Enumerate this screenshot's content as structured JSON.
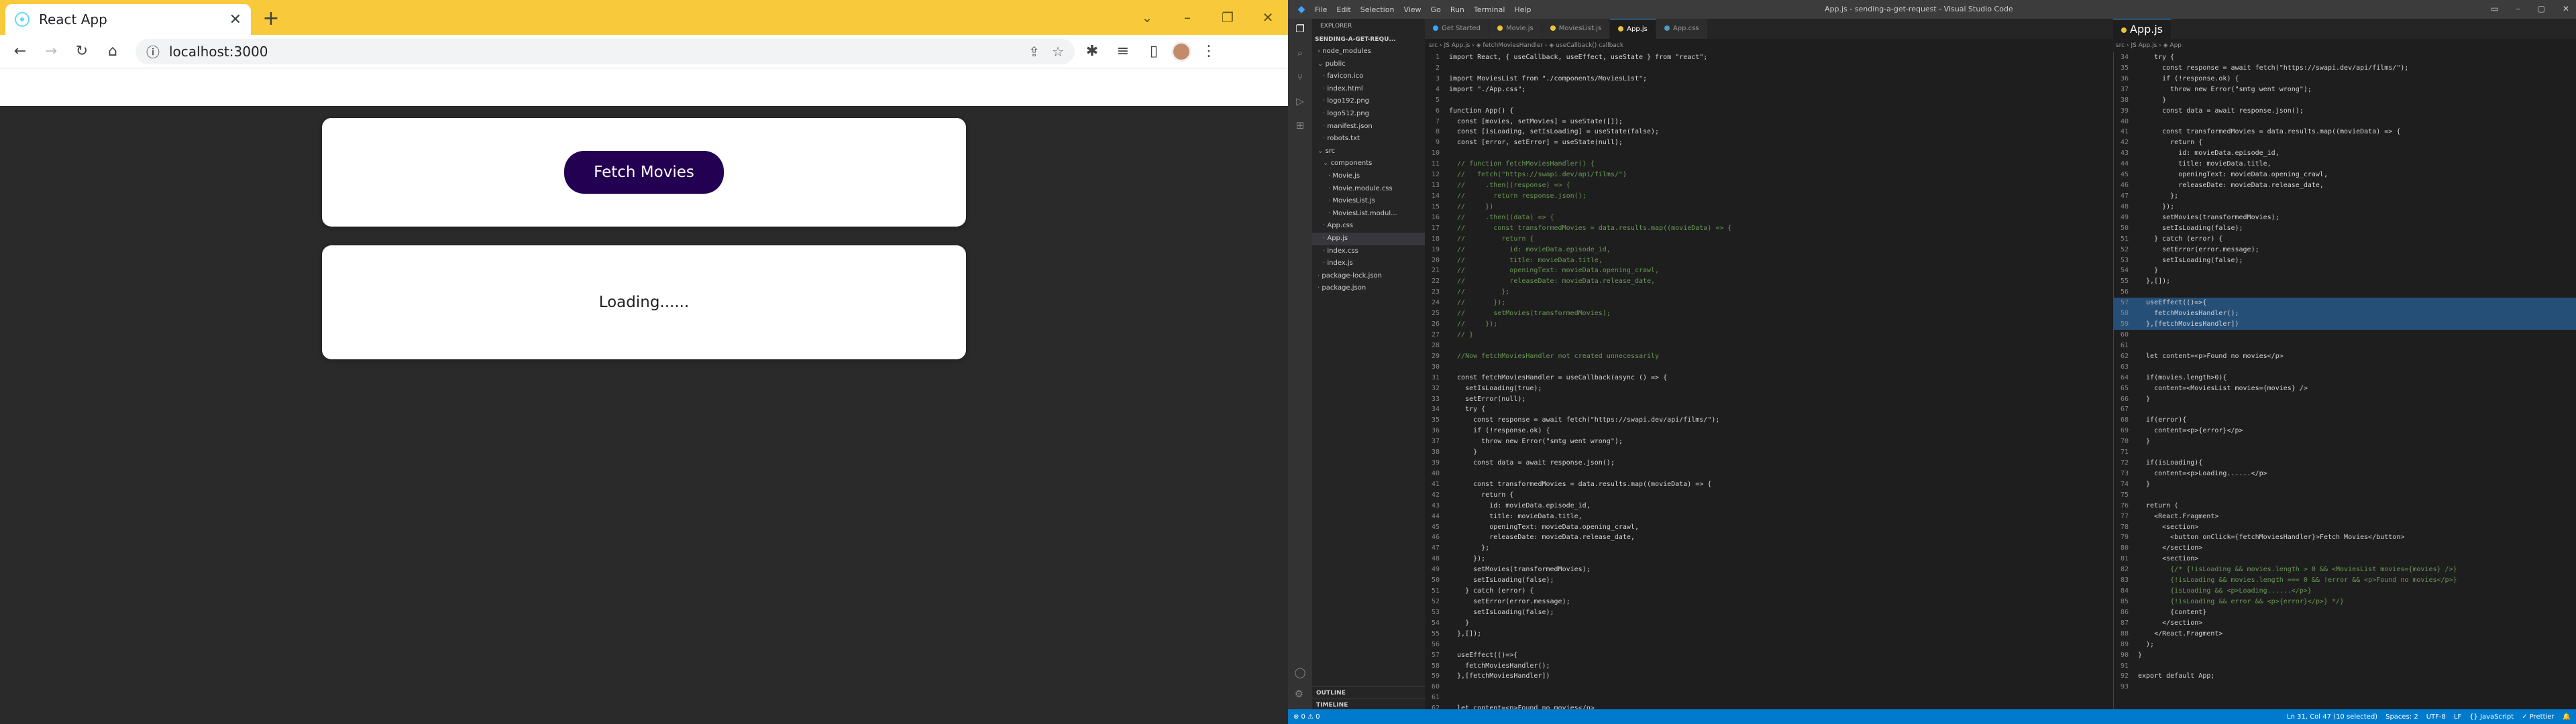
{
  "browser": {
    "tab_title": "React App",
    "tab_close": "✕",
    "new_tab": "+",
    "url": "localhost:3000",
    "window_controls": [
      "⌄",
      "–",
      "❐",
      "✕"
    ]
  },
  "app": {
    "fetch_button_label": "Fetch Movies",
    "loading_text": "Loading......"
  },
  "vscode": {
    "menu": [
      "File",
      "Edit",
      "Selection",
      "View",
      "Go",
      "Run",
      "Terminal",
      "Help"
    ],
    "window_title": "App.js - sending-a-get-request - Visual Studio Code",
    "explorer_header": "EXPLORER",
    "project_name": "SENDING-A-GET-REQU...",
    "tree": [
      {
        "label": "node_modules",
        "indent": 1,
        "arrow": "›"
      },
      {
        "label": "public",
        "indent": 1,
        "arrow": "⌄"
      },
      {
        "label": "favicon.ico",
        "indent": 2,
        "arrow": ""
      },
      {
        "label": "index.html",
        "indent": 2,
        "arrow": ""
      },
      {
        "label": "logo192.png",
        "indent": 2,
        "arrow": ""
      },
      {
        "label": "logo512.png",
        "indent": 2,
        "arrow": ""
      },
      {
        "label": "manifest.json",
        "indent": 2,
        "arrow": ""
      },
      {
        "label": "robots.txt",
        "indent": 2,
        "arrow": ""
      },
      {
        "label": "src",
        "indent": 1,
        "arrow": "⌄"
      },
      {
        "label": "components",
        "indent": 2,
        "arrow": "⌄"
      },
      {
        "label": "Movie.js",
        "indent": 3,
        "arrow": ""
      },
      {
        "label": "Movie.module.css",
        "indent": 3,
        "arrow": ""
      },
      {
        "label": "MoviesList.js",
        "indent": 3,
        "arrow": ""
      },
      {
        "label": "MoviesList.modul...",
        "indent": 3,
        "arrow": ""
      },
      {
        "label": "App.css",
        "indent": 2,
        "arrow": ""
      },
      {
        "label": "App.js",
        "indent": 2,
        "arrow": "",
        "selected": true
      },
      {
        "label": "index.css",
        "indent": 2,
        "arrow": ""
      },
      {
        "label": "index.js",
        "indent": 2,
        "arrow": ""
      },
      {
        "label": "package-lock.json",
        "indent": 1,
        "arrow": ""
      },
      {
        "label": "package.json",
        "indent": 1,
        "arrow": ""
      }
    ],
    "outline": "OUTLINE",
    "timeline": "TIMELINE",
    "tabs": [
      {
        "label": "Get Started",
        "color": "#3aa6ff"
      },
      {
        "label": "Movie.js",
        "color": "#e8c43a"
      },
      {
        "label": "MoviesList.js",
        "color": "#e8c43a"
      },
      {
        "label": "App.js",
        "color": "#e8c43a",
        "active": true
      },
      {
        "label": "App.css",
        "color": "#519aba"
      }
    ],
    "right_tab": "App.js",
    "breadcrumb_left": "src  ›  JS App.js  ›  ◈ fetchMoviesHandler  ›  ◈ useCallback() callback",
    "breadcrumb_right": "src  ›  JS App.js  ›  ◈ App",
    "code_left": [
      {
        "n": "1",
        "t": "import React, { useCallback, useEffect, useState } from \"react\";"
      },
      {
        "n": "2",
        "t": ""
      },
      {
        "n": "3",
        "t": "import MoviesList from \"./components/MoviesList\";"
      },
      {
        "n": "4",
        "t": "import \"./App.css\";"
      },
      {
        "n": "5",
        "t": ""
      },
      {
        "n": "6",
        "t": "function App() {"
      },
      {
        "n": "7",
        "t": "  const [movies, setMovies] = useState([]);"
      },
      {
        "n": "8",
        "t": "  const [isLoading, setIsLoading] = useState(false);"
      },
      {
        "n": "9",
        "t": "  const [error, setError] = useState(null);"
      },
      {
        "n": "10",
        "t": ""
      },
      {
        "n": "11",
        "t": "  // function fetchMoviesHandler() {",
        "c": 1
      },
      {
        "n": "12",
        "t": "  //   fetch(\"https://swapi.dev/api/films/\")",
        "c": 1
      },
      {
        "n": "13",
        "t": "  //     .then((response) => {",
        "c": 1
      },
      {
        "n": "14",
        "t": "  //       return response.json();",
        "c": 1
      },
      {
        "n": "15",
        "t": "  //     })",
        "c": 1
      },
      {
        "n": "16",
        "t": "  //     .then((data) => {",
        "c": 1
      },
      {
        "n": "17",
        "t": "  //       const transformedMovies = data.results.map((movieData) => {",
        "c": 1
      },
      {
        "n": "18",
        "t": "  //         return {",
        "c": 1
      },
      {
        "n": "19",
        "t": "  //           id: movieData.episode_id,",
        "c": 1
      },
      {
        "n": "20",
        "t": "  //           title: movieData.title,",
        "c": 1
      },
      {
        "n": "21",
        "t": "  //           openingText: movieData.opening_crawl,",
        "c": 1
      },
      {
        "n": "22",
        "t": "  //           releaseDate: movieData.release_date,",
        "c": 1
      },
      {
        "n": "23",
        "t": "  //         };",
        "c": 1
      },
      {
        "n": "24",
        "t": "  //       });",
        "c": 1
      },
      {
        "n": "25",
        "t": "  //       setMovies(transformedMovies);",
        "c": 1
      },
      {
        "n": "26",
        "t": "  //     });",
        "c": 1
      },
      {
        "n": "27",
        "t": "  // }",
        "c": 1
      },
      {
        "n": "28",
        "t": ""
      },
      {
        "n": "29",
        "t": "  //Now fetchMoviesHandler not created unnecessarily",
        "c": 1
      },
      {
        "n": "30",
        "t": ""
      },
      {
        "n": "31",
        "t": "  const fetchMoviesHandler = useCallback(async () => {"
      },
      {
        "n": "32",
        "t": "    setIsLoading(true);"
      },
      {
        "n": "33",
        "t": "    setError(null);"
      },
      {
        "n": "34",
        "t": "    try {"
      },
      {
        "n": "35",
        "t": "      const response = await fetch(\"https://swapi.dev/api/films/\");"
      },
      {
        "n": "36",
        "t": "      if (!response.ok) {"
      },
      {
        "n": "37",
        "t": "        throw new Error(\"smtg went wrong\");"
      },
      {
        "n": "38",
        "t": "      }"
      },
      {
        "n": "39",
        "t": "      const data = await response.json();"
      },
      {
        "n": "40",
        "t": ""
      },
      {
        "n": "41",
        "t": "      const transformedMovies = data.results.map((movieData) => {"
      },
      {
        "n": "42",
        "t": "        return {"
      },
      {
        "n": "43",
        "t": "          id: movieData.episode_id,"
      },
      {
        "n": "44",
        "t": "          title: movieData.title,"
      },
      {
        "n": "45",
        "t": "          openingText: movieData.opening_crawl,"
      },
      {
        "n": "46",
        "t": "          releaseDate: movieData.release_date,"
      },
      {
        "n": "47",
        "t": "        };"
      },
      {
        "n": "48",
        "t": "      });"
      },
      {
        "n": "49",
        "t": "      setMovies(transformedMovies);"
      },
      {
        "n": "50",
        "t": "      setIsLoading(false);"
      },
      {
        "n": "51",
        "t": "    } catch (error) {"
      },
      {
        "n": "52",
        "t": "      setError(error.message);"
      },
      {
        "n": "53",
        "t": "      setIsLoading(false);"
      },
      {
        "n": "54",
        "t": "    }"
      },
      {
        "n": "55",
        "t": "  },[]);"
      },
      {
        "n": "56",
        "t": ""
      },
      {
        "n": "57",
        "t": "  useEffect(()=>{"
      },
      {
        "n": "58",
        "t": "    fetchMoviesHandler();"
      },
      {
        "n": "59",
        "t": "  },[fetchMoviesHandler])"
      },
      {
        "n": "60",
        "t": ""
      },
      {
        "n": "61",
        "t": ""
      },
      {
        "n": "62",
        "t": "  let content=<p>Found no movies</p>"
      }
    ],
    "code_right": [
      {
        "n": "34",
        "t": "    try {"
      },
      {
        "n": "35",
        "t": "      const response = await fetch(\"https://swapi.dev/api/films/\");"
      },
      {
        "n": "36",
        "t": "      if (!response.ok) {"
      },
      {
        "n": "37",
        "t": "        throw new Error(\"smtg went wrong\");"
      },
      {
        "n": "38",
        "t": "      }"
      },
      {
        "n": "39",
        "t": "      const data = await response.json();"
      },
      {
        "n": "40",
        "t": ""
      },
      {
        "n": "41",
        "t": "      const transformedMovies = data.results.map((movieData) => {"
      },
      {
        "n": "42",
        "t": "        return {"
      },
      {
        "n": "43",
        "t": "          id: movieData.episode_id,"
      },
      {
        "n": "44",
        "t": "          title: movieData.title,"
      },
      {
        "n": "45",
        "t": "          openingText: movieData.opening_crawl,"
      },
      {
        "n": "46",
        "t": "          releaseDate: movieData.release_date,"
      },
      {
        "n": "47",
        "t": "        };"
      },
      {
        "n": "48",
        "t": "      });"
      },
      {
        "n": "49",
        "t": "      setMovies(transformedMovies);"
      },
      {
        "n": "50",
        "t": "      setIsLoading(false);"
      },
      {
        "n": "51",
        "t": "    } catch (error) {"
      },
      {
        "n": "52",
        "t": "      setError(error.message);"
      },
      {
        "n": "53",
        "t": "      setIsLoading(false);"
      },
      {
        "n": "54",
        "t": "    }"
      },
      {
        "n": "55",
        "t": "  },[]);"
      },
      {
        "n": "56",
        "t": ""
      },
      {
        "n": "57",
        "t": "  useEffect(()=>{",
        "h": 1
      },
      {
        "n": "58",
        "t": "    fetchMoviesHandler();",
        "h": 1
      },
      {
        "n": "59",
        "t": "  },[fetchMoviesHandler])",
        "h": 1
      },
      {
        "n": "60",
        "t": ""
      },
      {
        "n": "61",
        "t": ""
      },
      {
        "n": "62",
        "t": "  let content=<p>Found no movies</p>"
      },
      {
        "n": "63",
        "t": ""
      },
      {
        "n": "64",
        "t": "  if(movies.length>0){"
      },
      {
        "n": "65",
        "t": "    content=<MoviesList movies={movies} />"
      },
      {
        "n": "66",
        "t": "  }"
      },
      {
        "n": "67",
        "t": ""
      },
      {
        "n": "68",
        "t": "  if(error){"
      },
      {
        "n": "69",
        "t": "    content=<p>{error}</p>"
      },
      {
        "n": "70",
        "t": "  }"
      },
      {
        "n": "71",
        "t": ""
      },
      {
        "n": "72",
        "t": "  if(isLoading){"
      },
      {
        "n": "73",
        "t": "    content=<p>Loading......</p>"
      },
      {
        "n": "74",
        "t": "  }"
      },
      {
        "n": "75",
        "t": ""
      },
      {
        "n": "76",
        "t": "  return ("
      },
      {
        "n": "77",
        "t": "    <React.Fragment>"
      },
      {
        "n": "78",
        "t": "      <section>"
      },
      {
        "n": "79",
        "t": "        <button onClick={fetchMoviesHandler}>Fetch Movies</button>"
      },
      {
        "n": "80",
        "t": "      </section>"
      },
      {
        "n": "81",
        "t": "      <section>"
      },
      {
        "n": "82",
        "t": "        {/* {!isLoading && movies.length > 0 && <MoviesList movies={movies} />}",
        "c": 1
      },
      {
        "n": "83",
        "t": "        {!isLoading && movies.length === 0 && !error && <p>Found no movies</p>}",
        "c": 1
      },
      {
        "n": "84",
        "t": "        {isLoading && <p>Loading......</p>}",
        "c": 1
      },
      {
        "n": "85",
        "t": "        {!isLoading && error && <p>{error}</p>} */}",
        "c": 1
      },
      {
        "n": "86",
        "t": "        {content}"
      },
      {
        "n": "87",
        "t": "      </section>"
      },
      {
        "n": "88",
        "t": "    </React.Fragment>"
      },
      {
        "n": "89",
        "t": "  );"
      },
      {
        "n": "90",
        "t": "}"
      },
      {
        "n": "91",
        "t": ""
      },
      {
        "n": "92",
        "t": "export default App;"
      },
      {
        "n": "93",
        "t": ""
      }
    ],
    "status_left": [
      "⊗ 0  ⚠ 0"
    ],
    "status_right": [
      "Ln 31, Col 47 (10 selected)",
      "Spaces: 2",
      "UTF-8",
      "LF",
      "{} JavaScript",
      "✓ Prettier",
      "🔔"
    ]
  }
}
